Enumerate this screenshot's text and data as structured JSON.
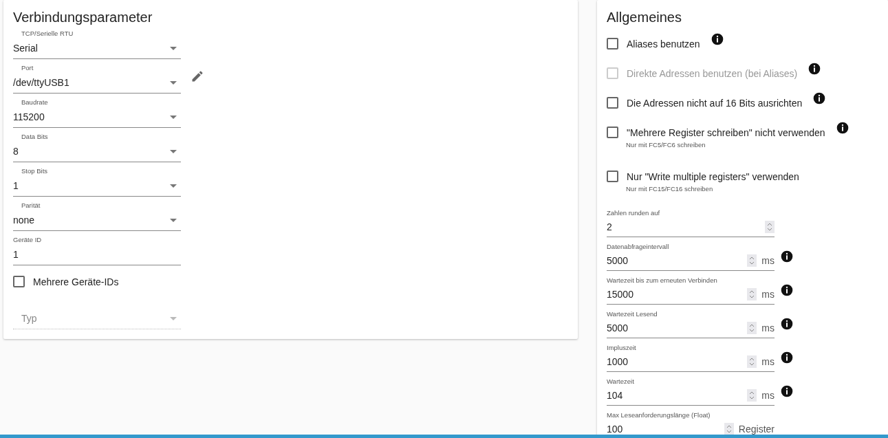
{
  "connection": {
    "title": "Verbindungsparameter",
    "fields": [
      {
        "kind": "select",
        "label": "TCP/Serielle RTU",
        "value": "Serial",
        "disabled": false
      },
      {
        "kind": "select",
        "label": "Port",
        "value": "/dev/ttyUSB1",
        "disabled": false,
        "editable": true
      },
      {
        "kind": "select",
        "label": "Baudrate",
        "value": "115200",
        "disabled": false
      },
      {
        "kind": "select",
        "label": "Data Bits",
        "value": "8",
        "disabled": false
      },
      {
        "kind": "select",
        "label": "Stop Bits",
        "value": "1",
        "disabled": false
      },
      {
        "kind": "select",
        "label": "Parität",
        "value": "none",
        "disabled": false
      },
      {
        "kind": "text",
        "label": "Geräte ID",
        "value": "1"
      },
      {
        "kind": "checkbox",
        "label": "Mehrere Geräte-IDs",
        "checked": false,
        "disabled": false
      },
      {
        "kind": "select",
        "placeholder": "Typ",
        "disabled": true
      }
    ]
  },
  "general": {
    "title": "Allgemeines",
    "options": [
      {
        "label": "Aliases benutzen",
        "checked": false,
        "disabled": false,
        "info": true
      },
      {
        "label": "Direkte Adressen benutzen (bei Aliases)",
        "checked": false,
        "disabled": true,
        "info": true
      },
      {
        "label": "Die Adressen nicht auf 16 Bits ausrichten",
        "checked": false,
        "disabled": false,
        "info": true
      },
      {
        "label": "\"Mehrere Register schreiben\" nicht verwenden",
        "checked": false,
        "disabled": false,
        "info": true,
        "hint": "Nur mit FC5/FC6 schreiben"
      },
      {
        "label": "Nur \"Write multiple registers\" verwenden",
        "checked": false,
        "disabled": false,
        "info": false,
        "hint": "Nur mit FC15/FC16 schreiben"
      }
    ],
    "numbers": [
      {
        "label": "Zahlen runden auf",
        "value": "2",
        "info": false
      },
      {
        "label": "Datenabfrageintervall",
        "value": "5000",
        "unit": "ms",
        "info": true
      },
      {
        "label": "Wartezeit bis zum erneuten Verbinden",
        "value": "15000",
        "unit": "ms",
        "info": true
      },
      {
        "label": "Wartezeit Lesend",
        "value": "5000",
        "unit": "ms",
        "info": true
      },
      {
        "label": "Impluszeit",
        "value": "1000",
        "unit": "ms",
        "info": true
      },
      {
        "label": "Wartezeit",
        "value": "104",
        "unit": "ms",
        "info": true
      },
      {
        "label": "Max Leseanforderungslänge (Float)",
        "value": "100",
        "unit": "Register",
        "info": false
      }
    ]
  }
}
